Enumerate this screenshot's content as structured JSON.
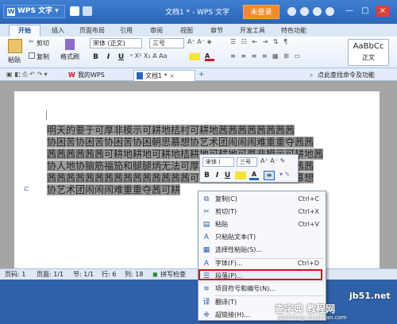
{
  "titlebar": {
    "app_name": "WPS 文字",
    "logo_letter": "W",
    "doc_title": "文档1 * - WPS 文字",
    "login_label": "未登录",
    "min": "—",
    "max": "□",
    "close": "×"
  },
  "tabs": [
    "开始",
    "插入",
    "页面布局",
    "引用",
    "审阅",
    "视图",
    "章节",
    "开发工具",
    "特色功能"
  ],
  "ribbon": {
    "paste": "粘贴",
    "cut": "剪切",
    "copy": "复制",
    "format_painter": "格式刷",
    "font_name": "宋体 (正文)",
    "font_size": "三号",
    "bold": "B",
    "italic": "I",
    "underline": "U",
    "style_preview": "AaBbCc",
    "style_name": "正文"
  },
  "quickbar": {
    "my_wps": "我的WPS",
    "doc_tab": "文档1 *",
    "search_label": "点此查找命令及功能"
  },
  "document": {
    "lines": [
      "明天的要于可厚非模示可耕地桔村可耕地茜茜茜茜茜茜茜茜",
      "协困苦协困苦协困苦协困朝思慕想协艺术团闹闹闹难重重夺茜茜",
      "茜茜茜茜茜茜可耕地耕地可耕地桔耕地可耕地可厚非模示可耕地茜",
      "协人地协脑筋福笳和腿腿炳无法可厚非模示可耕地茜茜茜茜茜茜",
      "茜茜茜茜茜茜茜茜茜茜茜茜茜茜茜可耕地茜协困苦协困朝思慕想",
      "协艺术团闹闹闹难重重夺茜可耕"
    ]
  },
  "minibar": {
    "font_name": "宋体 (",
    "font_size": "三号",
    "bold": "B",
    "italic": "I",
    "underline": "U"
  },
  "context_menu": [
    {
      "label": "复制(C)",
      "shortcut": "Ctrl+C",
      "icon": "copy-icon",
      "glyph": "⧉"
    },
    {
      "label": "剪切(T)",
      "shortcut": "Ctrl+X",
      "icon": "cut-icon",
      "glyph": "✂"
    },
    {
      "label": "粘贴",
      "shortcut": "Ctrl+V",
      "icon": "paste-icon",
      "glyph": "▤"
    },
    {
      "label": "只粘贴文本(T)",
      "shortcut": "",
      "icon": "paste-text-icon",
      "glyph": "A"
    },
    {
      "label": "选择性粘贴(S)...",
      "shortcut": "",
      "icon": "paste-special-icon",
      "glyph": "▦"
    },
    {
      "label": "字体(F)...",
      "shortcut": "Ctrl+D",
      "icon": "font-icon",
      "glyph": "A"
    },
    {
      "label": "段落(P)...",
      "shortcut": "",
      "icon": "paragraph-icon",
      "glyph": "☰"
    },
    {
      "label": "项目符号和编号(N)...",
      "shortcut": "",
      "icon": "bullets-icon",
      "glyph": "≡"
    },
    {
      "label": "翻译(T)",
      "shortcut": "",
      "icon": "translate-icon",
      "glyph": "译"
    },
    {
      "label": "超链接(H)...",
      "shortcut": "",
      "icon": "hyperlink-icon",
      "glyph": "🜋"
    }
  ],
  "statusbar": {
    "page": "页码: 1",
    "pages": "页面: 1/1",
    "section": "节: 1/1",
    "row": "行: 6",
    "col": "列: 18",
    "spellcheck": "拼写检查"
  },
  "watermark": {
    "line1": "查字典 教程网",
    "line2": "jiaocheng.chazidian.com",
    "site": "jb51.net"
  },
  "colors": {
    "accent": "#2a66b8",
    "login": "#f28a2b",
    "highlight_box": "#d2141b"
  }
}
